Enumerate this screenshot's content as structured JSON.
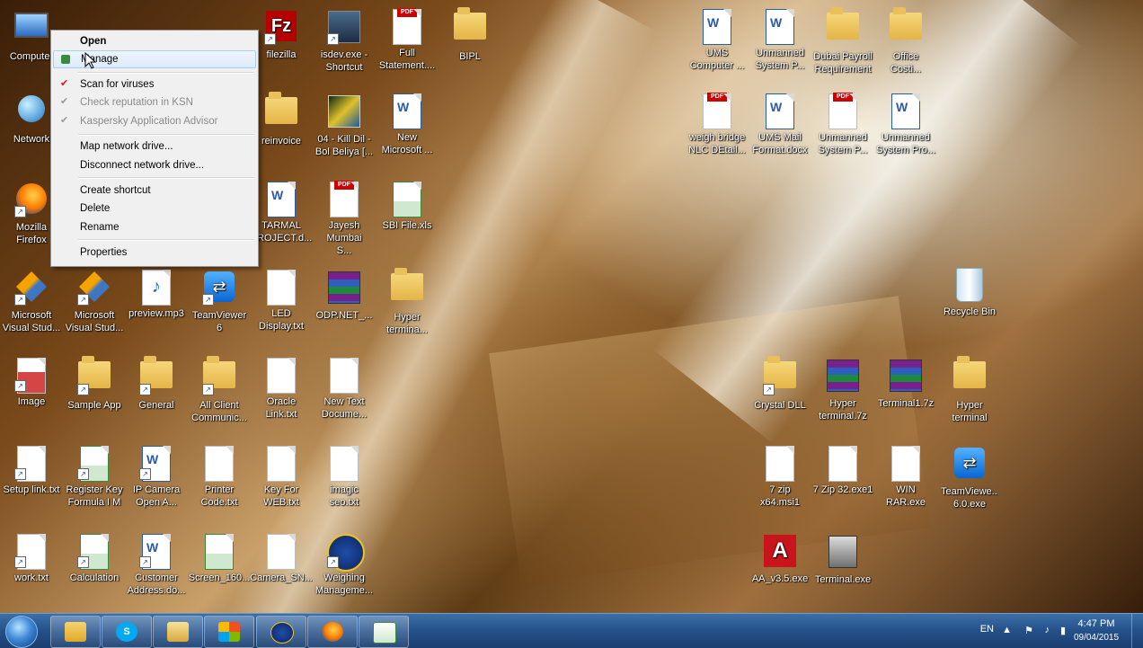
{
  "desktop_icons": {
    "computer": "Computer",
    "network": "Network",
    "firefox": "Mozilla Firefox",
    "filezilla": "filezilla",
    "isdev": "isdev.exe - Shortcut",
    "full_statement": "Full Statement....",
    "bipl": "BIPL",
    "reinvoice": "reinvoice",
    "kill_dil": "04 - Kill Dil - Bol Beliya [...",
    "new_microsoft": "New Microsoft ...",
    "tarmal": "TARMAL PROJECT.d...",
    "jayesh": "Jayesh Mumbai S...",
    "sbi_file": "SBI File.xls",
    "ms_visual_1": "Microsoft Visual Stud...",
    "ms_visual_2": "Microsoft Visual Stud...",
    "preview_mp3": "preview.mp3",
    "teamviewer6": "TeamViewer 6",
    "led_display": "LED Display.txt",
    "odp_net": "ODP.NET_...",
    "hyper_terminal_1": "Hyper termina...",
    "image": "Image",
    "sample_app": "Sample App",
    "general": "General",
    "all_client": "All Client Communic...",
    "oracle_link": "Oracle Link.txt",
    "new_text": "New Text Docume...",
    "setup_link": "Setup link.txt",
    "register_key": "Register Key Formula I M",
    "ip_camera": "IP Camera Open A...",
    "printer_code": "Printer Code.txt",
    "key_for_web": "Key For WEB.txt",
    "imagic_seo": "imagic seo.txt",
    "work_txt": "work.txt",
    "calculation": "Calculation",
    "customer_address": "Customer Address.do...",
    "screen_160": "Screen_160...",
    "camera_sn": "Camera_SN...",
    "weighing_mgmt": "Weighing Manageme...",
    "ums_computer": "UMS Computer ...",
    "unmanned_1": "Unmanned System P...",
    "dubai_payroll": "Dubai Payroll Requirement",
    "office_costing": "Office Costi...",
    "weigh_bridge": "weigh bridge NLC DEtail...",
    "ums_mail": "UMS Mail Format.docx",
    "unmanned_2": "Unmanned System P...",
    "unmanned_3": "Unmanned System Pro...",
    "recycle_bin": "Recycle Bin",
    "crystal_dll": "Crystal DLL",
    "hyper_terminal_7z": "Hyper terminal.7z",
    "terminal17z": "Terminal1.7z",
    "hyper_terminal_2": "Hyper terminal",
    "zip_x64": "7 zip x64.msi1",
    "zip_32": "7 Zip 32.exe1",
    "win_rar": "WIN RAR.exe1",
    "teamviewer60": "TeamViewe... 6.0.exe",
    "aa_v35": "AA_v3.5.exe",
    "terminal_exe": "Terminal.exe"
  },
  "context_menu": {
    "open": "Open",
    "manage": "Manage",
    "scan": "Scan for viruses",
    "check_reputation": "Check reputation in KSN",
    "kaspersky_advisor": "Kaspersky Application Advisor",
    "map_drive": "Map network drive...",
    "disconnect_drive": "Disconnect network drive...",
    "create_shortcut": "Create shortcut",
    "delete": "Delete",
    "rename": "Rename",
    "properties": "Properties"
  },
  "taskbar": {
    "language": "EN",
    "time": "4:47 PM",
    "date": "09/04/2015"
  },
  "colors": {
    "taskbar": "#24508a",
    "menu_bg": "#f0f0f0",
    "menu_highlight": "#dcebfc"
  }
}
